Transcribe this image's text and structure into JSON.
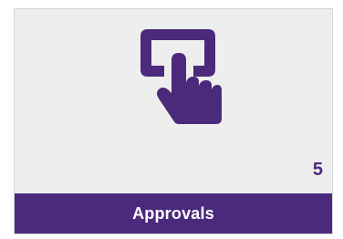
{
  "tile": {
    "label": "Approvals",
    "count": "5",
    "icon": "touch-screen-tap-icon"
  },
  "colors": {
    "accent": "#4b2a7b",
    "tile_background": "#eeeeee",
    "label_text": "#ffffff"
  }
}
